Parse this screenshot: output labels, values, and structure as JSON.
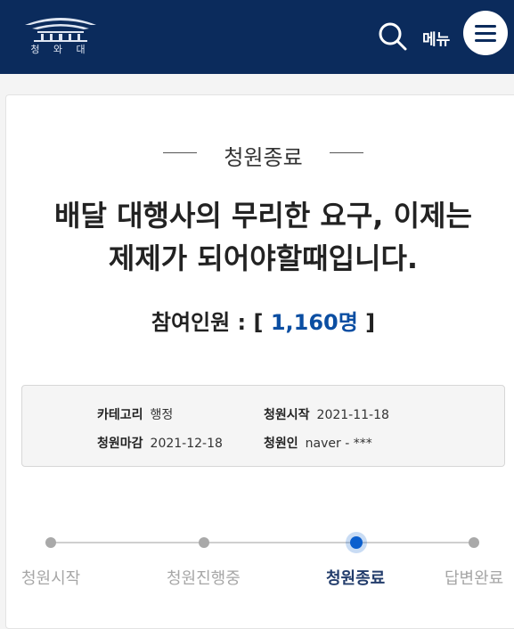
{
  "header": {
    "logo_text": "청 와 대",
    "menu_label": "메뉴"
  },
  "petition": {
    "status": "청원종료",
    "title_line1": "배달 대행사의 무리한 요구, 이제는",
    "title_line2": "제제가 되어야할때입니다.",
    "participants_label": "참여인원 : [ ",
    "participants_count": "1,160명",
    "participants_close": " ]",
    "info": {
      "category_label": "카테고리",
      "category_value": "행정",
      "start_label": "청원시작",
      "start_value": "2021-11-18",
      "end_label": "청원마감",
      "end_value": "2021-12-18",
      "author_label": "청원인",
      "author_value": "naver - ***"
    }
  },
  "progress": {
    "steps": [
      "청원시작",
      "청원진행중",
      "청원종료",
      "답변완료"
    ],
    "active_index": 2
  },
  "colors": {
    "header_bg": "#0b2b5c",
    "accent": "#0b4ea2",
    "active_dot": "#0b5fce"
  }
}
